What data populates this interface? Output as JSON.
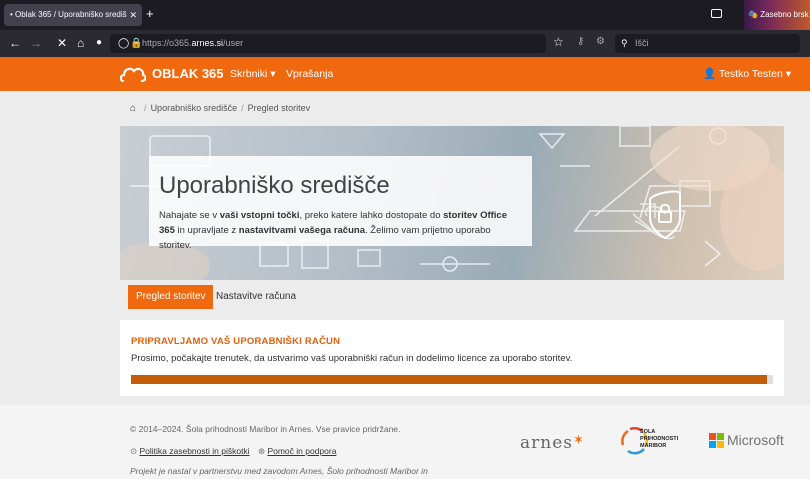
{
  "browser": {
    "tab_title": "• Oblak 365 / Uporabniško središ",
    "tab_close": "✕",
    "new_tab": "+",
    "private_label": "Zasebno brsk",
    "url_prefix": "https://o365.",
    "url_host": "arnes.si",
    "url_path": "/user",
    "search_placeholder": "Išči"
  },
  "app": {
    "brand": "OBLAK 365",
    "menu": [
      "Skrbniki ▾",
      "Vprašanja"
    ],
    "user": "Testko Testen ▾",
    "accent": "#f1690f"
  },
  "breadcrumb": {
    "items": [
      "Uporabniško središče",
      "Pregled storitev"
    ],
    "separator": "/"
  },
  "hero": {
    "title": "Uporabniško središče",
    "text_1": "Nahajate se v ",
    "bold_1": "vaši vstopni točki",
    "text_2": ", preko katere lahko dostopate do ",
    "bold_2": "storitev Office 365",
    "text_3": " in upravljate z ",
    "bold_3": "nastavitvami vašega računa",
    "text_4": ". Želimo vam prijetno uporabo storitev."
  },
  "tabs": [
    "Pregled storitev",
    "Nastavitve računa"
  ],
  "card": {
    "title": "PRIPRAVLJAMO VAŠ UPORABNIŠKI RAČUN",
    "text": "Prosimo, počakajte trenutek, da ustvarimo vaš uporabniški račun in dodelimo licence za uporabo storitev.",
    "progress": 0.99
  },
  "footer": {
    "copyright": "© 2014–2024. Šola prihodnosti Maribor in Arnes. Vse pravice pridržane.",
    "privacy": "Politika zasebnosti in piškotki",
    "help": "Pomoč in podpora",
    "note": "Projekt je nastal v partnerstvu med zavodom Arnes, Šolo prihodnosti Maribor in",
    "logo_arnes": "arnes",
    "logo_sola": "ŠOLA PRIHODNOSTI MARIBOR",
    "logo_ms": "Microsoft"
  }
}
